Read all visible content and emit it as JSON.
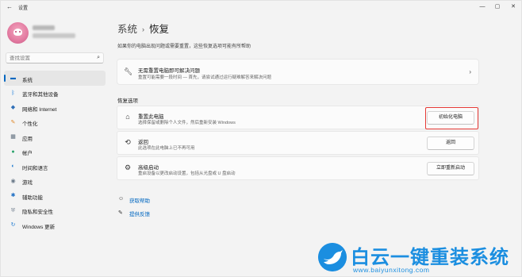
{
  "window": {
    "app_title": "设置",
    "back_icon": "back-arrow-icon",
    "controls": {
      "minimize": "—",
      "maximize": "▢",
      "close": "✕"
    }
  },
  "search": {
    "placeholder": "查找设置",
    "value": "查找设置"
  },
  "sidebar": {
    "items": [
      {
        "label": "系统",
        "icon": "monitor-icon",
        "glyph": "▬",
        "color": "#0067c0",
        "active": true
      },
      {
        "label": "蓝牙和其他设备",
        "icon": "bluetooth-icon",
        "glyph": "ᛒ",
        "color": "#0a74d9",
        "active": false
      },
      {
        "label": "网络和 Internet",
        "icon": "wifi-icon",
        "glyph": "◆",
        "color": "#2f6fb7",
        "active": false
      },
      {
        "label": "个性化",
        "icon": "brush-icon",
        "glyph": "✎",
        "color": "#e08a2e",
        "active": false
      },
      {
        "label": "应用",
        "icon": "apps-icon",
        "glyph": "▦",
        "color": "#5a6a7a",
        "active": false
      },
      {
        "label": "帐户",
        "icon": "person-icon",
        "glyph": "●",
        "color": "#2aa36b",
        "active": false
      },
      {
        "label": "时间和语言",
        "icon": "globe-clock-icon",
        "glyph": "◐",
        "color": "#1f7bd1",
        "active": false
      },
      {
        "label": "游戏",
        "icon": "gamepad-icon",
        "glyph": "◉",
        "color": "#6b7a8a",
        "active": false
      },
      {
        "label": "辅助功能",
        "icon": "accessibility-icon",
        "glyph": "✱",
        "color": "#1f6fc4",
        "active": false
      },
      {
        "label": "隐私和安全性",
        "icon": "shield-icon",
        "glyph": "⛨",
        "color": "#7a8796",
        "active": false
      },
      {
        "label": "Windows 更新",
        "icon": "windows-update-icon",
        "glyph": "↻",
        "color": "#1f7bd1",
        "active": false
      }
    ]
  },
  "main": {
    "breadcrumb_parent": "系统",
    "breadcrumb_sep": "›",
    "breadcrumb_current": "恢复",
    "description": "如果你的电脑出现问题或需要重置，这些恢复选项可能有所帮助",
    "troubleshoot_card": {
      "icon": "wrench-icon",
      "title": "无需重置电脑即可解决问题",
      "desc": "重置可能需要一段时间 — 首先，请尝试通过运行疑难解答来解决问题"
    },
    "section_title": "恢复选项",
    "options": [
      {
        "icon": "reset-pc-icon",
        "glyph": "⌂",
        "title": "重置此电脑",
        "desc": "选择保留或删除个人文件，然后重新安装 Windows",
        "button": "初始化电脑",
        "highlighted": true
      },
      {
        "icon": "history-icon",
        "glyph": "⟲",
        "title": "返回",
        "desc": "此选项在此电脑上已不再可用",
        "button": "返回",
        "highlighted": false
      },
      {
        "icon": "advanced-startup-icon",
        "glyph": "⚙",
        "title": "高级启动",
        "desc": "重启设备以更改启动设置，包括从光盘或 U 盘启动",
        "button": "立即重新启动",
        "highlighted": false
      }
    ],
    "links": [
      {
        "icon": "help-icon",
        "glyph": "☺",
        "label": "获取帮助"
      },
      {
        "icon": "feedback-icon",
        "glyph": "✎",
        "label": "提供反馈"
      }
    ]
  },
  "watermark": {
    "title": "白云一键重装系统",
    "url": "www.baiyunxitong.com",
    "icon": "bird-logo-icon"
  }
}
